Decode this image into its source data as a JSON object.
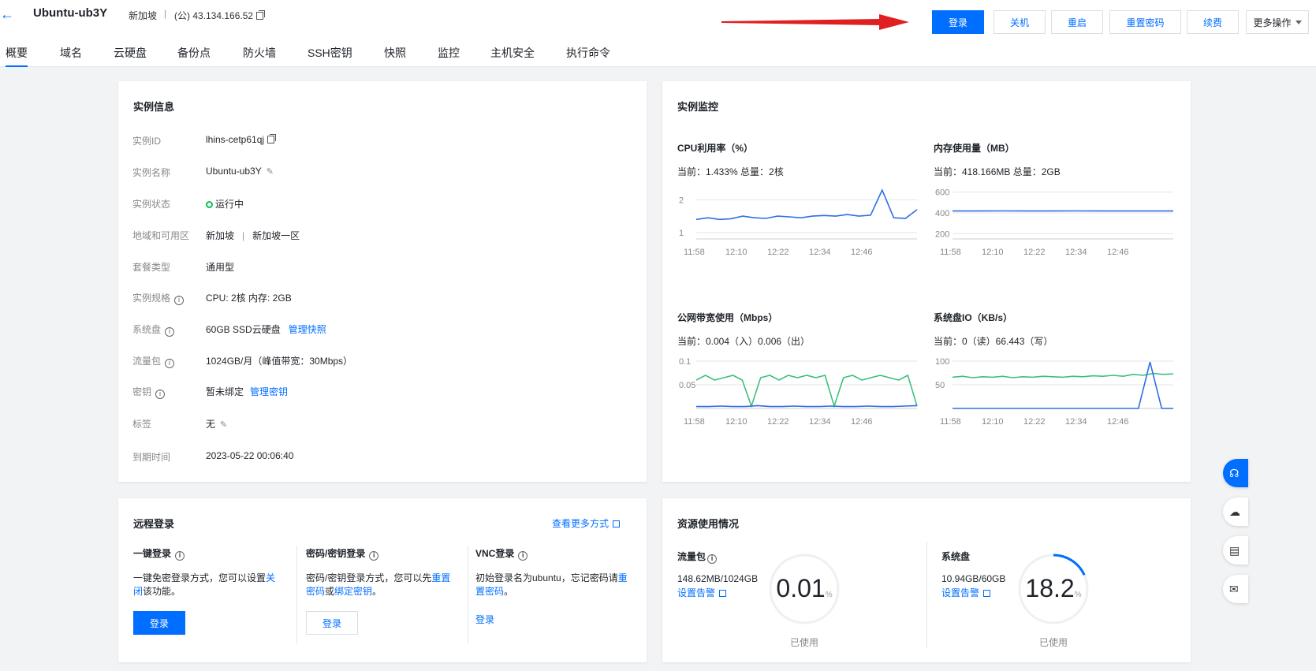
{
  "header": {
    "back_icon": "arrow-left-icon",
    "instance_name": "Ubuntu-ub3Y",
    "region": "新加坡",
    "separator": "|",
    "ip": "(公) 43.134.166.52",
    "buttons": {
      "login": "登录",
      "shutdown": "关机",
      "restart": "重启",
      "reset_password": "重置密码",
      "renew": "续费",
      "more": "更多操作"
    }
  },
  "tabs": [
    "概要",
    "域名",
    "云硬盘",
    "备份点",
    "防火墙",
    "SSH密钥",
    "快照",
    "监控",
    "主机安全",
    "执行命令"
  ],
  "instance_info": {
    "title": "实例信息",
    "rows": [
      {
        "label": "实例ID",
        "value": "lhins-cetp61qj"
      },
      {
        "label": "实例名称",
        "value": "Ubuntu-ub3Y"
      },
      {
        "label": "实例状态",
        "value": "运行中"
      },
      {
        "label": "地域和可用区",
        "value": "新加坡",
        "sep": "|",
        "value2": "新加坡一区"
      },
      {
        "label": "套餐类型",
        "value": "通用型"
      },
      {
        "label": "实例规格",
        "value": "CPU: 2核 内存: 2GB"
      },
      {
        "label": "系统盘",
        "value": "60GB SSD云硬盘",
        "link": "管理快照"
      },
      {
        "label": "流量包",
        "value": "1024GB/月（峰值带宽：30Mbps）"
      },
      {
        "label": "密钥",
        "value": "暂未绑定",
        "link": "管理密钥"
      },
      {
        "label": "标签",
        "value": "无"
      },
      {
        "label": "到期时间",
        "value": "2023-05-22 00:06:40"
      }
    ]
  },
  "monitor": {
    "title": "实例监控",
    "colors": {
      "blue": "#2e6ee6",
      "green": "#3ec07a",
      "grid": "#e5e6eb"
    },
    "charts": [
      {
        "title": "CPU利用率（%）",
        "current": "当前：1.433% 总量：2核"
      },
      {
        "title": "内存使用量（MB）",
        "current": "当前：418.166MB 总量：2GB"
      },
      {
        "title": "公网带宽使用（Mbps）",
        "current": "当前：0.004（入）0.006（出）"
      },
      {
        "title": "系统盘IO（KB/s）",
        "current": "当前：0（读）66.443（写）"
      }
    ]
  },
  "chart_data": [
    {
      "type": "line",
      "title": "CPU利用率（%）",
      "x": [
        "11:58",
        "12:10",
        "12:22",
        "12:34",
        "12:46"
      ],
      "yticks": [
        "2",
        "1"
      ],
      "series": [
        {
          "values": [
            1.4,
            1.45,
            1.4,
            1.42,
            1.5,
            1.45,
            1.43,
            1.5,
            1.48,
            1.45,
            1.5,
            1.52,
            1.5,
            1.55,
            1.5,
            1.53,
            2.3,
            1.45,
            1.43,
            1.7
          ]
        }
      ]
    },
    {
      "type": "line",
      "title": "内存使用量（MB）",
      "x": [
        "11:58",
        "12:10",
        "12:22",
        "12:34",
        "12:46"
      ],
      "yticks": [
        "600",
        "400",
        "200"
      ],
      "series": [
        {
          "values": [
            418,
            418,
            419,
            418,
            418,
            419,
            418,
            418,
            418,
            418
          ]
        }
      ]
    },
    {
      "type": "line",
      "title": "公网带宽使用（Mbps）",
      "x": [
        "11:58",
        "12:10",
        "12:22",
        "12:34",
        "12:46"
      ],
      "yticks": [
        "0.1",
        "0.05"
      ],
      "series": [
        {
          "values": [
            0.06,
            0.07,
            0.06,
            0.065,
            0.07,
            0.06,
            0.005,
            0.065,
            0.07,
            0.06,
            0.07,
            0.065,
            0.07,
            0.065,
            0.07,
            0.005,
            0.065,
            0.07,
            0.06,
            0.065,
            0.07,
            0.065,
            0.06,
            0.07,
            0.005
          ]
        },
        {
          "values": [
            0.004,
            0.004,
            0.005,
            0.004,
            0.004,
            0.006,
            0.004,
            0.004,
            0.005,
            0.004,
            0.004,
            0.005,
            0.004,
            0.004,
            0.005,
            0.004,
            0.004,
            0.005,
            0.006
          ]
        }
      ]
    },
    {
      "type": "line",
      "title": "系统盘IO（KB/s）",
      "x": [
        "11:58",
        "12:10",
        "12:22",
        "12:34",
        "12:46"
      ],
      "yticks": [
        "100",
        "50"
      ],
      "series": [
        {
          "values": [
            66,
            68,
            65,
            67,
            66,
            68,
            65,
            67,
            66,
            68,
            67,
            66,
            68,
            67,
            69,
            68,
            70,
            68,
            72,
            70,
            74,
            72,
            73
          ]
        },
        {
          "values": [
            0,
            0,
            0,
            0,
            0,
            0,
            0,
            0,
            0,
            0,
            0,
            0,
            0,
            0,
            0,
            0,
            0,
            98,
            0,
            0
          ]
        }
      ]
    }
  ],
  "remote_login": {
    "title": "远程登录",
    "more_link": "查看更多方式",
    "one_click": {
      "title": "一键登录",
      "desc1": "一键免密登录方式，您可以设置",
      "link1": "关闭",
      "desc2": "该功能。",
      "button": "登录"
    },
    "password": {
      "title": "密码/密钥登录",
      "desc1": "密码/密钥登录方式，您可以先",
      "link1": "重置密码",
      "mid": "或",
      "link2": "绑定密钥",
      "end": "。",
      "button": "登录"
    },
    "vnc": {
      "title": "VNC登录",
      "desc1": "初始登录名为ubuntu，忘记密码请",
      "link1": "重置密码",
      "end": "。",
      "button": "登录"
    }
  },
  "resource": {
    "title": "资源使用情况",
    "traffic": {
      "title": "流量包",
      "usage": "148.62MB/1024GB",
      "link": "设置告警",
      "percent": "0.01",
      "unit": "%",
      "caption": "已使用",
      "fraction": 0.0001
    },
    "disk": {
      "title": "系统盘",
      "usage": "10.94GB/60GB",
      "link": "设置告警",
      "percent": "18.2",
      "unit": "%",
      "caption": "已使用",
      "fraction": 0.182
    }
  }
}
